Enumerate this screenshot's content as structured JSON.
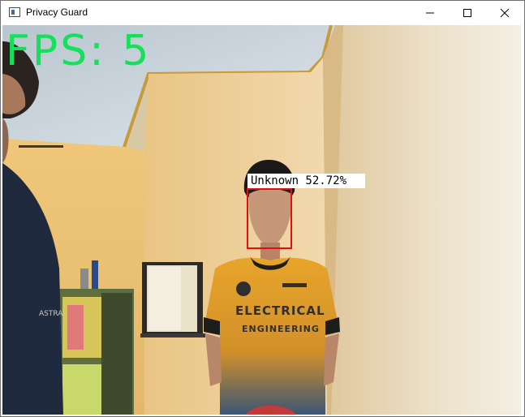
{
  "window": {
    "title": "Privacy Guard",
    "icon": "window-app-icon",
    "controls": [
      "minimize-icon",
      "maximize-icon",
      "close-icon"
    ]
  },
  "overlay": {
    "fps_text": "FPS: 5",
    "detection_label": "Unknown 52.72%"
  },
  "colors": {
    "fps_text": "#16e05a",
    "detection_box": "#e01010",
    "label_background": "#ffffff"
  }
}
